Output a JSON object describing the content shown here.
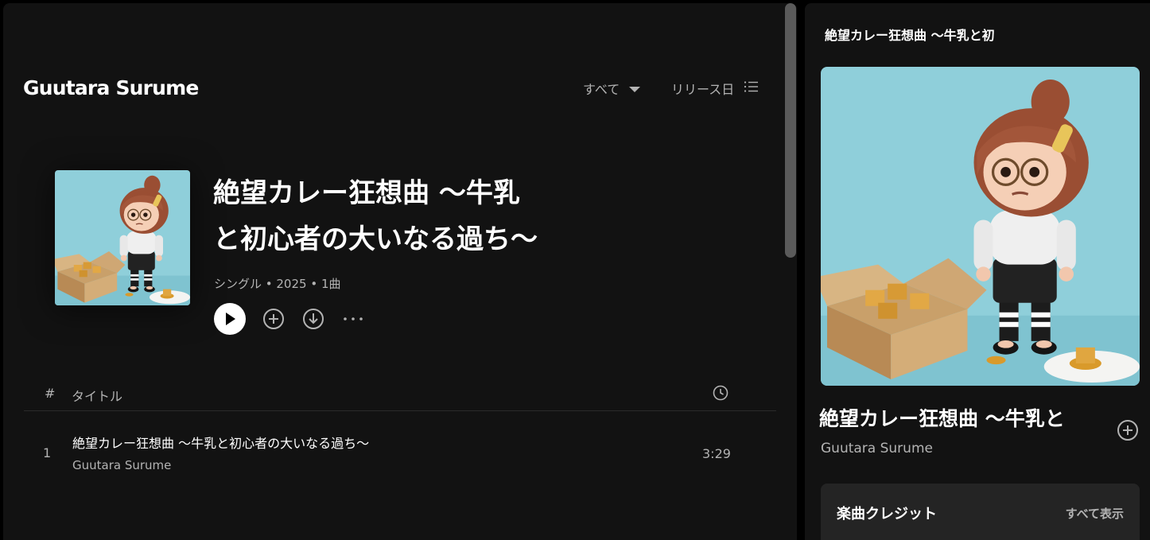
{
  "artist": {
    "name": "Guutara Surume"
  },
  "filters": {
    "filter_label": "すべて",
    "sort_label": "リリース日"
  },
  "album": {
    "title_line1": "絶望カレー狂想曲 ～牛乳",
    "title_line2": "と初心者の大いなる過ち～",
    "meta": "シングル • 2025 • 1曲",
    "cover_icon": "album-art-chibi-girl-curry-icon"
  },
  "track_list": {
    "header_num": "#",
    "header_title": "タイトル",
    "header_duration_icon": "clock-icon",
    "tracks": [
      {
        "number": "1",
        "title": "絶望カレー狂想曲 ～牛乳と初心者の大いなる過ち～",
        "artist": "Guutara Surume",
        "duration": "3:29"
      }
    ]
  },
  "now_playing": {
    "header": "絶望カレー狂想曲 ～牛乳と初",
    "title": "絶望カレー狂想曲 ～牛乳と",
    "artist": "Guutara Surume",
    "credits_title": "楽曲クレジット",
    "credits_show_all": "すべて表示"
  },
  "colors": {
    "background": "#000000",
    "panel": "#121212",
    "card": "#242424",
    "text_primary": "#ffffff",
    "text_secondary": "#b3b3b3",
    "cover_background": "#8fcfda"
  }
}
